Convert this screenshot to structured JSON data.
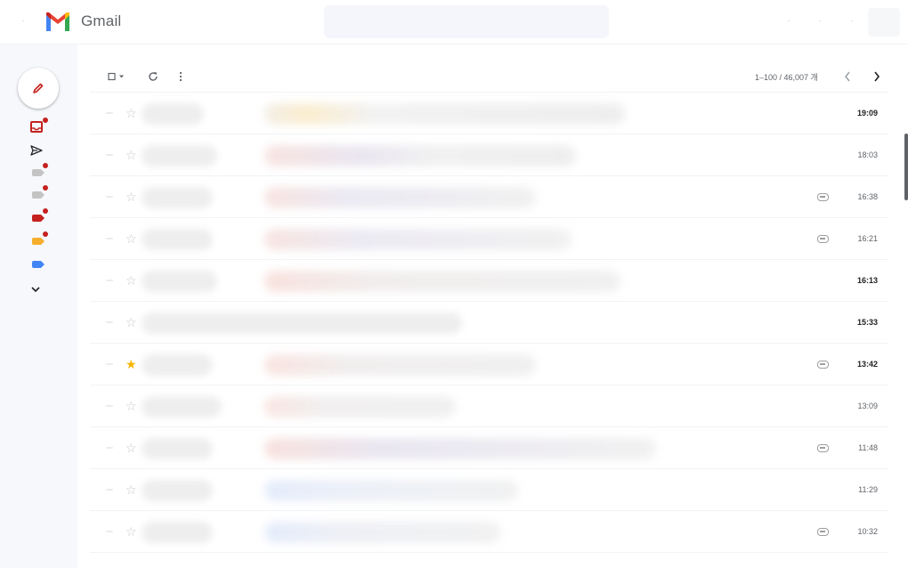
{
  "header": {
    "app_name": "Gmail",
    "icons": [
      "menu-icon",
      "gmail-logo",
      "help-icon",
      "settings-icon",
      "apps-icon",
      "avatar"
    ]
  },
  "colors": {
    "gmail_red": "#ea4335",
    "gmail_blue": "#4285f4",
    "gmail_green": "#34a853",
    "gmail_yellow": "#fbbc04",
    "dark_red": "#c5221f",
    "star_yellow": "#f4b400",
    "sidebar_bg": "#f6f8fc",
    "search_bg": "#f4f6fb"
  },
  "sidebar": {
    "items": [
      {
        "name": "inbox",
        "icon": "inbox-icon",
        "badge": true
      },
      {
        "name": "sent",
        "icon": "send-icon",
        "badge": false
      },
      {
        "name": "label-1",
        "icon": "label-icon",
        "color": "gray",
        "badge": true
      },
      {
        "name": "label-2",
        "icon": "label-icon",
        "color": "gray",
        "badge": true
      },
      {
        "name": "label-3",
        "icon": "label-icon",
        "color": "red",
        "badge": true
      },
      {
        "name": "label-4",
        "icon": "label-icon",
        "color": "orange",
        "badge": true
      },
      {
        "name": "label-5",
        "icon": "label-icon",
        "color": "blue",
        "badge": false
      },
      {
        "name": "more",
        "icon": "chevron-down-icon",
        "badge": false
      }
    ]
  },
  "toolbar": {
    "pagination": "1–100 / 46,007 개"
  },
  "emails": [
    {
      "time": "19:09",
      "unread": true,
      "starred": false,
      "attachment": false
    },
    {
      "time": "18:03",
      "unread": false,
      "starred": false,
      "attachment": false
    },
    {
      "time": "16:38",
      "unread": false,
      "starred": false,
      "attachment": true
    },
    {
      "time": "16:21",
      "unread": false,
      "starred": false,
      "attachment": true
    },
    {
      "time": "16:13",
      "unread": true,
      "starred": false,
      "attachment": false
    },
    {
      "time": "15:33",
      "unread": true,
      "starred": false,
      "attachment": false
    },
    {
      "time": "13:42",
      "unread": true,
      "starred": true,
      "attachment": true
    },
    {
      "time": "13:09",
      "unread": false,
      "starred": false,
      "attachment": false
    },
    {
      "time": "11:48",
      "unread": false,
      "starred": false,
      "attachment": true
    },
    {
      "time": "11:29",
      "unread": false,
      "starred": false,
      "attachment": false
    },
    {
      "time": "10:32",
      "unread": false,
      "starred": false,
      "attachment": true
    }
  ]
}
